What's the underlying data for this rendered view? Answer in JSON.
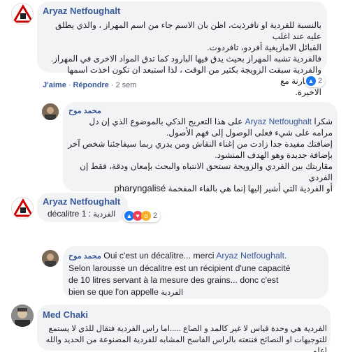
{
  "comments": [
    {
      "author": "Aryaz Netfoughalt",
      "lines": [
        "بالنسبة للفردية او تافرذيث، اظن بان الاسم جاء من اسم المهراز ، والذي يطلق عليه عند اغلب",
        "القبائل الامازيغية أفردو، تافردوت.",
        "فالفردية تشبه المهراز بحيث يدق فيها البارود كما تدق المواد الاخرى في المهراز.",
        "والفردية سبقت الزويجة بكثير من الوقت ، لذا استبعد ان تكون اخذت اسمها بالمقارنة مع",
        "الاخيرة."
      ],
      "like_label": "J'aime",
      "reply_label": "Répondre",
      "time": "2 sem",
      "reaction_count": "2"
    },
    {
      "author": "محمد موح",
      "mention": "Aryaz Netfoughalt",
      "line1_before": "شكرا",
      "line1_after": "على هذا التعريج الذكي بالموضوع الذي إن دل",
      "lines": [
        "مرامه على شيء فعلى الوصول إلى فهم الأصول.",
        "إضافتك مفيدة جدا زادت من إغناء النقاش ومن يدري ربما سيفاجئنا شخص آخر",
        "بإضافة جديدة وهو الهدف المنشود.",
        "مقاربتك بين الفردي والزويجة تستحق الانتباه والبحث بإمعان ودقة، فقط إن الفردي"
      ],
      "last_line_ar": "أو الفردية التي أشير إليها إنما هي بالفاء المفخمة",
      "last_line_fr": "pharyngalisé"
    },
    {
      "author": "Aryaz Netfoughalt",
      "text_fr": "décalitre 1 :",
      "text_ar": "الفردية",
      "reaction_count": "2"
    },
    {
      "author": "محمد موح",
      "text_start": "Oui c'est un décalitre... merci ",
      "mention": "Aryaz Netfoughalt",
      "text_after_mention": ".",
      "lines": [
        "Selon larousse un décalitre est un récipient d'une capacité",
        "de 10 litres servant à la mesure des grains... donc c'est"
      ],
      "last_line_fr": "bien se que l'on appelle",
      "last_line_ar": "الفردية"
    },
    {
      "author": "Med Chaki",
      "lines": [
        "الفردية هي وحدة قياس لا غير كالمد و الصاع .....اما راس الفردية فتقال للذي لا يستمع",
        "للتوجيهات او النصائح فننعته بالراس الفاسح المشابه للفردية المصنوعة من الحديد والله اعلم"
      ]
    }
  ],
  "colors": {
    "bubble": "#f2f3f5",
    "link": "#385898",
    "like": "#1877f2",
    "love": "#f33e58",
    "wow": "#f7b125"
  }
}
